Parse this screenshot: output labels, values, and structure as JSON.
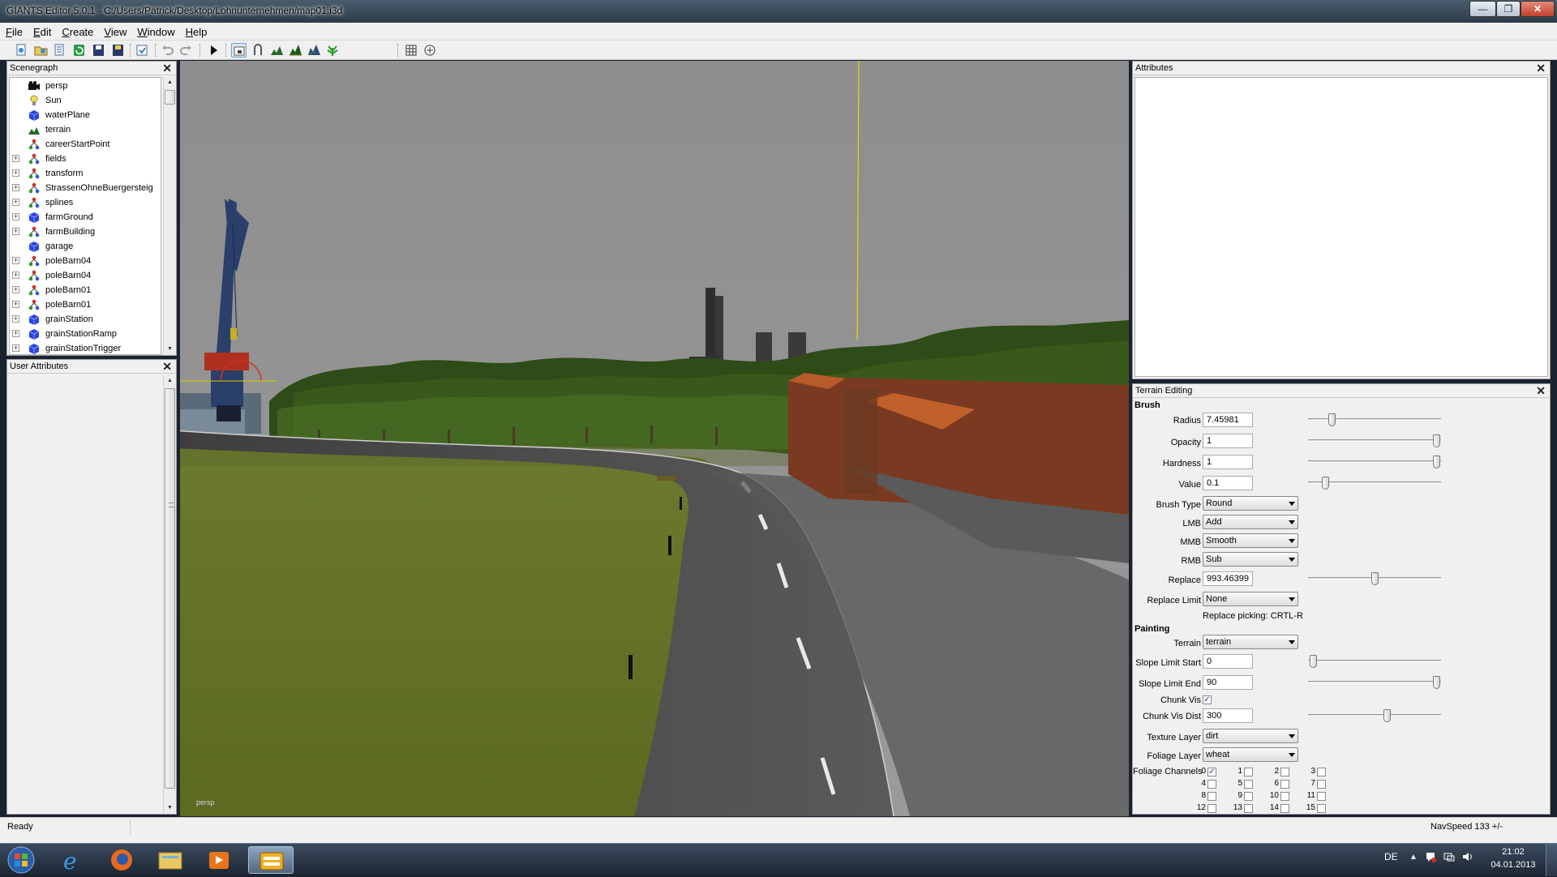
{
  "window": {
    "title": "GIANTS Editor 5.0.1 - C:/Users/Patrick/Desktop/Lohnunternehmen/map01.i3d",
    "minimize": "—",
    "maximize": "❐",
    "close": "✕"
  },
  "menu": [
    "File",
    "Edit",
    "Create",
    "View",
    "Window",
    "Help"
  ],
  "toolbar_icons": [
    "new-icon",
    "open-icon",
    "open-recent-icon",
    "reload-icon",
    "save-icon",
    "save-as-icon",
    "import-icon",
    "undo-icon",
    "redo-icon",
    "play-icon",
    "select-icon",
    "move-icon",
    "terrain-sculpt-icon",
    "terrain-paint-icon",
    "terrain-detail-icon",
    "foliage-paint-icon",
    "snap-icon",
    "snap-settings-icon"
  ],
  "scenegraph": {
    "title": "Scenegraph",
    "items": [
      {
        "label": "persp",
        "icon": "camera",
        "expandable": false
      },
      {
        "label": "Sun",
        "icon": "light",
        "expandable": false
      },
      {
        "label": "waterPlane",
        "icon": "shape",
        "expandable": false
      },
      {
        "label": "terrain",
        "icon": "terrain",
        "expandable": false
      },
      {
        "label": "careerStartPoint",
        "icon": "transform",
        "expandable": false
      },
      {
        "label": "fields",
        "icon": "transform",
        "expandable": true
      },
      {
        "label": "transform",
        "icon": "transform",
        "expandable": true
      },
      {
        "label": "StrassenOhneBuergersteig",
        "icon": "transform",
        "expandable": true
      },
      {
        "label": "splines",
        "icon": "transform",
        "expandable": true
      },
      {
        "label": "farmGround",
        "icon": "shape",
        "expandable": true
      },
      {
        "label": "farmBuilding",
        "icon": "transform",
        "expandable": true
      },
      {
        "label": "garage",
        "icon": "shape",
        "expandable": false
      },
      {
        "label": "poleBarn04",
        "icon": "transform",
        "expandable": true
      },
      {
        "label": "poleBarn04",
        "icon": "transform",
        "expandable": true
      },
      {
        "label": "poleBarn01",
        "icon": "transform",
        "expandable": true
      },
      {
        "label": "poleBarn01",
        "icon": "transform",
        "expandable": true
      },
      {
        "label": "grainStation",
        "icon": "shape",
        "expandable": true
      },
      {
        "label": "grainStationRamp",
        "icon": "shape",
        "expandable": true
      },
      {
        "label": "grainStationTrigger",
        "icon": "shape",
        "expandable": true
      }
    ]
  },
  "user_attributes": {
    "title": "User Attributes"
  },
  "viewport": {
    "camera_label": "persp"
  },
  "attributes": {
    "title": "Attributes"
  },
  "terrain_editing": {
    "title": "Terrain Editing",
    "brush_heading": "Brush",
    "painting_heading": "Painting",
    "radius": {
      "label": "Radius",
      "value": "7.45981",
      "slider": 0.15
    },
    "opacity": {
      "label": "Opacity",
      "value": "1",
      "slider": 1.0
    },
    "hardness": {
      "label": "Hardness",
      "value": "1",
      "slider": 1.0
    },
    "value": {
      "label": "Value",
      "value": "0.1",
      "slider": 0.1
    },
    "brush_type": {
      "label": "Brush Type",
      "value": "Round"
    },
    "lmb": {
      "label": "LMB",
      "value": "Add"
    },
    "mmb": {
      "label": "MMB",
      "value": "Smooth"
    },
    "rmb": {
      "label": "RMB",
      "value": "Sub"
    },
    "replace": {
      "label": "Replace",
      "value": "993.46399",
      "slider": 0.5
    },
    "replace_limit": {
      "label": "Replace Limit",
      "value": "None"
    },
    "replace_hint": "Replace picking: CRTL-R",
    "terrain": {
      "label": "Terrain",
      "value": "terrain"
    },
    "slope_start": {
      "label": "Slope Limit Start",
      "value": "0",
      "slider": 0.0
    },
    "slope_end": {
      "label": "Slope Limit End",
      "value": "90",
      "slider": 1.0
    },
    "chunk_vis": {
      "label": "Chunk Vis",
      "checked": true
    },
    "chunk_vis_dist": {
      "label": "Chunk Vis Dist",
      "value": "300",
      "slider": 0.6
    },
    "texture_layer": {
      "label": "Texture Layer",
      "value": "dirt"
    },
    "foliage_layer": {
      "label": "Foliage Layer",
      "value": "wheat"
    },
    "foliage_channels_label": "Foliage Channels",
    "foliage_channels": [
      {
        "n": "0",
        "checked": true
      },
      {
        "n": "1",
        "checked": false
      },
      {
        "n": "2",
        "checked": false
      },
      {
        "n": "3",
        "checked": false
      },
      {
        "n": "4",
        "checked": false
      },
      {
        "n": "5",
        "checked": false
      },
      {
        "n": "6",
        "checked": false
      },
      {
        "n": "7",
        "checked": false
      },
      {
        "n": "8",
        "checked": false
      },
      {
        "n": "9",
        "checked": false
      },
      {
        "n": "10",
        "checked": false
      },
      {
        "n": "11",
        "checked": false
      },
      {
        "n": "12",
        "checked": false
      },
      {
        "n": "13",
        "checked": false
      },
      {
        "n": "14",
        "checked": false
      },
      {
        "n": "15",
        "checked": false
      }
    ]
  },
  "status": {
    "left": "Ready",
    "right": "NavSpeed 133 +/-"
  },
  "taskbar": {
    "apps": [
      "start-orb-icon",
      "internet-explorer-icon",
      "firefox-icon",
      "explorer-icon",
      "media-player-icon",
      "giants-editor-icon"
    ],
    "lang": "DE",
    "time": "21:02",
    "date": "04.01.2013"
  },
  "colors": {
    "sky": "#8d8d8d",
    "grass": "#6b7a2a",
    "road": "#4a4a4a",
    "trees": "#3a5a1c",
    "crane": "#2a3f6a",
    "accent_yellow": "#e8d800"
  }
}
